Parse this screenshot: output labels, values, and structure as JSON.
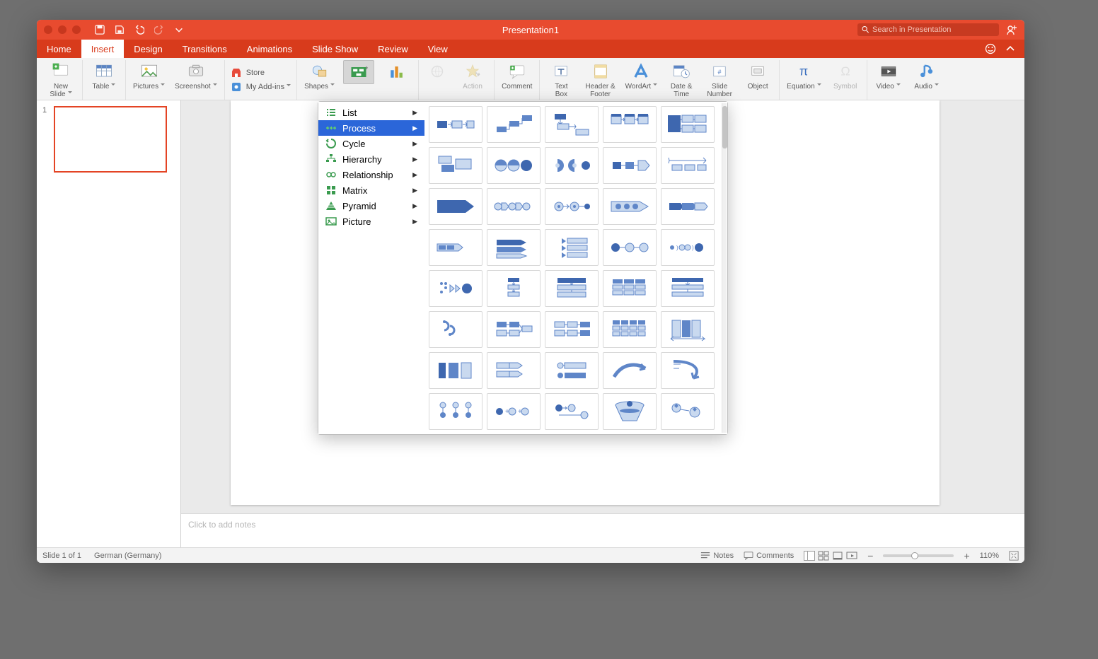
{
  "window": {
    "title": "Presentation1"
  },
  "search": {
    "placeholder": "Search in Presentation"
  },
  "tabs": {
    "home": "Home",
    "insert": "Insert",
    "design": "Design",
    "transitions": "Transitions",
    "animations": "Animations",
    "slide_show": "Slide Show",
    "review": "Review",
    "view": "View"
  },
  "ribbon": {
    "new_slide": "New\nSlide",
    "table": "Table",
    "pictures": "Pictures",
    "screenshot": "Screenshot",
    "store": "Store",
    "my_addins": "My Add-ins",
    "shapes": "Shapes",
    "smartart": "SmartArt",
    "chart": "Chart",
    "action": "Action",
    "comment": "Comment",
    "text_box": "Text\nBox",
    "header_footer": "Header &\nFooter",
    "wordart": "WordArt",
    "date_time": "Date &\nTime",
    "slide_number": "Slide\nNumber",
    "object": "Object",
    "equation": "Equation",
    "symbol": "Symbol",
    "video": "Video",
    "audio": "Audio"
  },
  "smartart": {
    "categories": {
      "list": "List",
      "process": "Process",
      "cycle": "Cycle",
      "hierarchy": "Hierarchy",
      "relationship": "Relationship",
      "matrix": "Matrix",
      "pyramid": "Pyramid",
      "picture": "Picture"
    }
  },
  "thumbs": {
    "slide1_num": "1"
  },
  "notes": {
    "placeholder": "Click to add notes"
  },
  "status": {
    "slide": "Slide 1 of 1",
    "lang": "German (Germany)",
    "notes": "Notes",
    "comments": "Comments",
    "zoom": "110%"
  }
}
